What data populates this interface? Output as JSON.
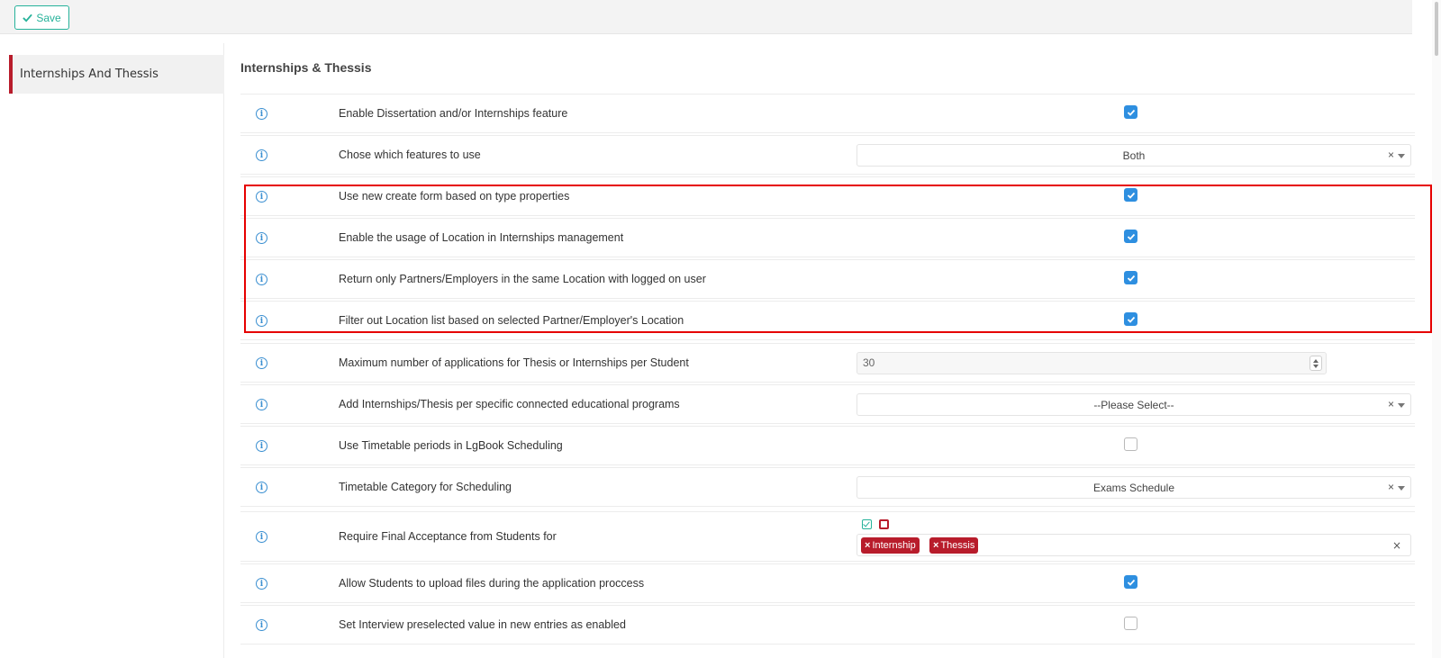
{
  "toolbar": {
    "save_label": "Save"
  },
  "sidebar": {
    "items": [
      {
        "label": "Internships And Thessis"
      }
    ]
  },
  "section": {
    "title": "Internships & Thessis"
  },
  "rows": [
    {
      "label": "Enable Dissertation and/or Internships feature",
      "type": "checkbox",
      "checked": true
    },
    {
      "label": "Chose which features to use",
      "type": "select",
      "value": "Both"
    },
    {
      "label": "Use new create form based on type properties",
      "type": "checkbox",
      "checked": true
    },
    {
      "label": "Enable the usage of Location in Internships management",
      "type": "checkbox",
      "checked": true
    },
    {
      "label": "Return only Partners/Employers in the same Location with logged on user",
      "type": "checkbox",
      "checked": true
    },
    {
      "label": "Filter out Location list based on selected Partner/Employer's Location",
      "type": "checkbox",
      "checked": true
    },
    {
      "label": "Maximum number of applications for Thesis or Internships per Student",
      "type": "number",
      "value": "30"
    },
    {
      "label": "Add Internships/Thesis per specific connected educational programs",
      "type": "select",
      "value": "--Please Select--"
    },
    {
      "label": "Use Timetable periods in LgBook Scheduling",
      "type": "checkbox",
      "checked": false
    },
    {
      "label": "Timetable Category for Scheduling",
      "type": "select",
      "value": "Exams Schedule"
    },
    {
      "label": "Require Final Acceptance from Students for",
      "type": "multiselect",
      "tags": [
        "Internship",
        "Thessis"
      ]
    },
    {
      "label": "Allow Students to upload files during the application proccess",
      "type": "checkbox",
      "checked": true
    },
    {
      "label": "Set Interview preselected value in new entries as enabled",
      "type": "checkbox",
      "checked": false
    }
  ],
  "glyphs": {
    "clear": "×",
    "info": "i"
  },
  "colors": {
    "accent_teal": "#26b29a",
    "accent_red": "#b81c2b",
    "checkbox_blue": "#2e8fe0",
    "highlight": "#e60000"
  }
}
